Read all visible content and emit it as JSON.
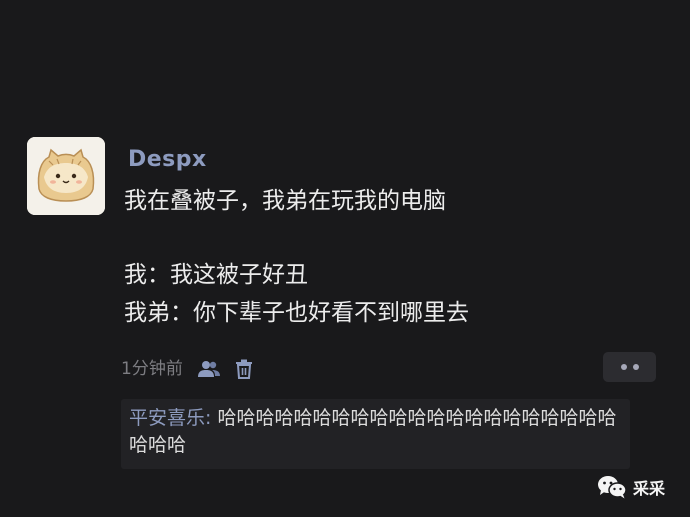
{
  "post": {
    "username": "Despx",
    "body_lines": [
      "我在叠被子，我弟在玩我的电脑",
      "我：我这被子好丑",
      "我弟：你下辈子也好看不到哪里去"
    ],
    "timestamp": "1分钟前",
    "more_icon": "more-dots-icon",
    "icons": [
      "users-icon",
      "trash-icon"
    ]
  },
  "comment": {
    "author": "平安喜乐",
    "separator": ": ",
    "text": "哈哈哈哈哈哈哈哈哈哈哈哈哈哈哈哈哈哈哈哈哈哈哈哈"
  },
  "watermark": {
    "icon": "wechat-icon",
    "label": "采采"
  }
}
